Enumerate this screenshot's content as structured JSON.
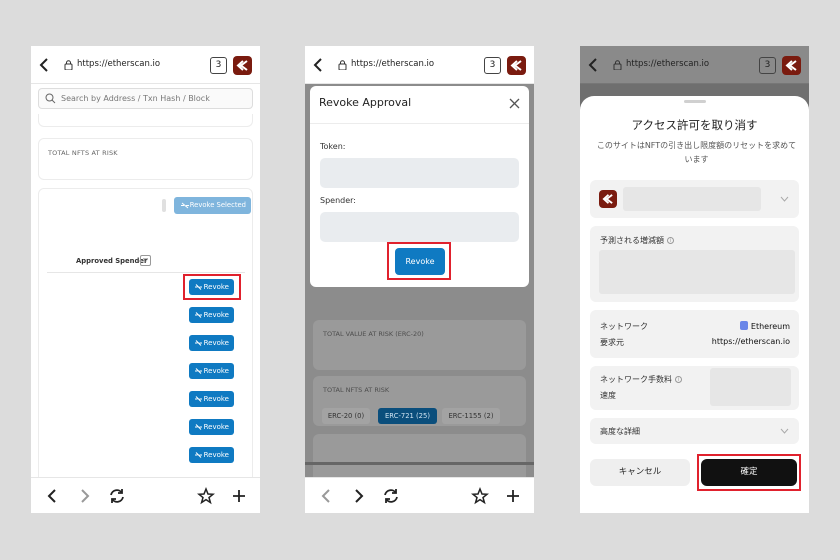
{
  "browser": {
    "url": "https://etherscan.io",
    "tab_count": "3"
  },
  "screen1": {
    "search_placeholder": "Search by Address / Txn Hash / Block",
    "total_nfts_label": "TOTAL NFTS AT RISK",
    "revoke_selected_label": "Revoke Selected",
    "approved_spender_label": "Approved Spender",
    "filter_icon": "▽",
    "revoke_buttons": [
      "Revoke",
      "Revoke",
      "Revoke",
      "Revoke",
      "Revoke",
      "Revoke",
      "Revoke"
    ]
  },
  "screen2": {
    "modal_title": "Revoke Approval",
    "token_label": "Token:",
    "spender_label": "Spender:",
    "revoke_button": "Revoke",
    "bg_total_value_label": "TOTAL VALUE AT RISK (ERC-20)",
    "bg_total_nfts_label": "TOTAL NFTS AT RISK",
    "bg_tabs": [
      "ERC-20 (0)",
      "ERC-721 (25)",
      "ERC-1155 (2)"
    ]
  },
  "screen3": {
    "title": "アクセス許可を取り消す",
    "subtitle": "このサイトはNFTの引き出し限度額のリセットを求めています",
    "estimated_change_label": "予測される増減額",
    "network_label": "ネットワーク",
    "network_value": "Ethereum",
    "requester_label": "要求元",
    "requester_value": "https://etherscan.io",
    "fee_label": "ネットワーク手数料",
    "speed_label": "速度",
    "advanced_label": "高度な詳細",
    "cancel_button": "キャンセル",
    "confirm_button": "確定"
  },
  "colors": {
    "accent_blue": "#0f7ac2",
    "highlight_red": "#e0212d",
    "app_icon_bg": "#7a1b0f"
  }
}
